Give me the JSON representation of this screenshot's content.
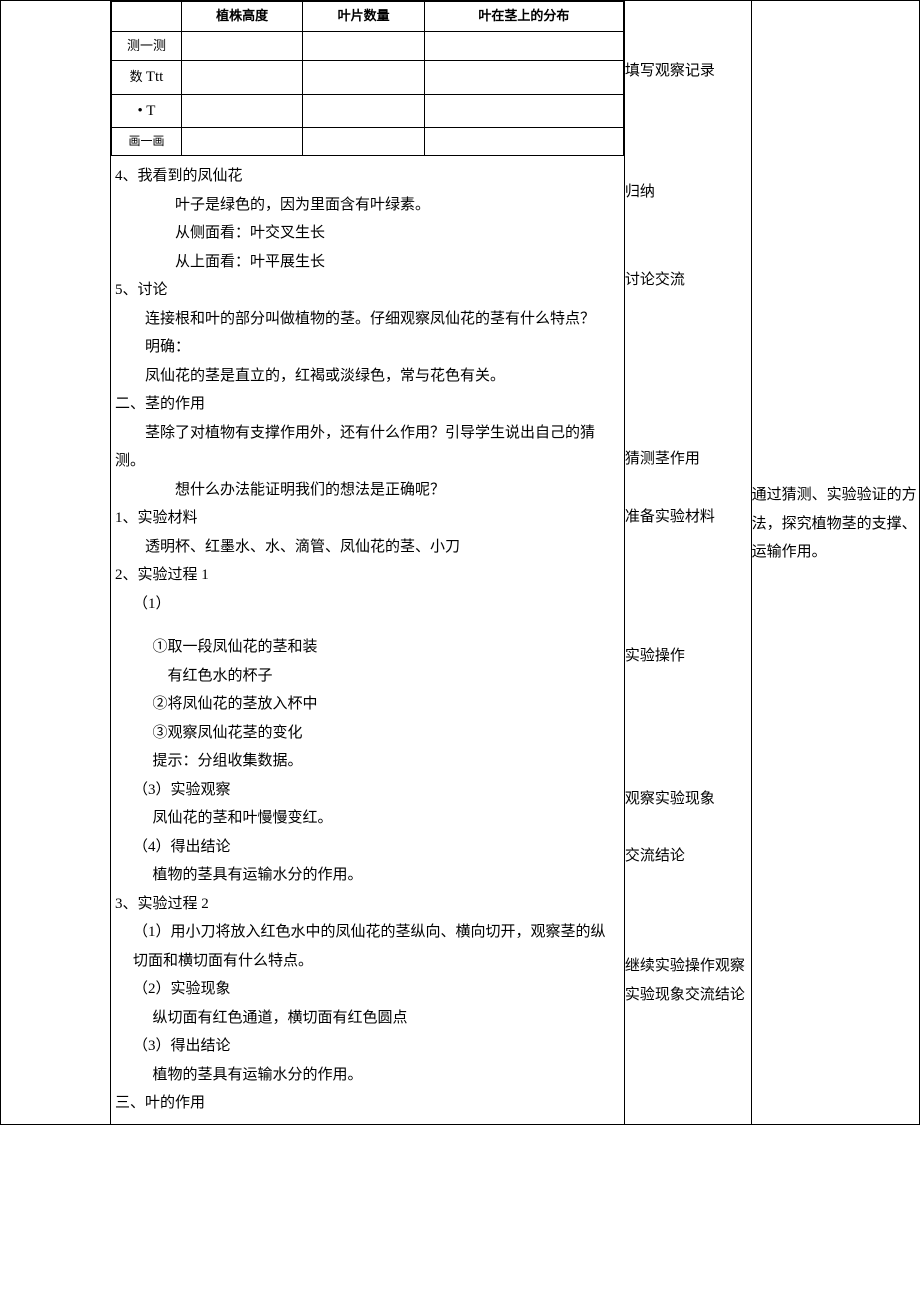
{
  "inner_table": {
    "headers": [
      "",
      "植株高度",
      "叶片数量",
      "叶在茎上的分布"
    ],
    "rows": [
      {
        "label": "测一测"
      },
      {
        "label_html": "数 Ttt"
      },
      {
        "label_html": "• T"
      },
      {
        "label": "画一画"
      }
    ]
  },
  "activities": {
    "a1": "填写观察记录",
    "a2": "归纳",
    "a3": "讨论交流",
    "a4": "猜测茎作用",
    "a5": "准备实验材料",
    "a6": "实验操作",
    "a7": "观察实验现象",
    "a8": "交流结论",
    "a9": "继续实验操作观察实验现象交流结论"
  },
  "note": "通过猜测、实验验证的方法，探究植物茎的支撑、运输作用。",
  "content": {
    "s4_title": "4、我看到的凤仙花",
    "s4_l1": "叶子是绿色的，因为里面含有叶绿素。",
    "s4_l2": "从侧面看：叶交叉生长",
    "s4_l3": "从上面看：叶平展生长",
    "s5_title": "5、讨论",
    "s5_l1": "连接根和叶的部分叫做植物的茎。仔细观察凤仙花的茎有什么特点？",
    "s5_l2": "明确：",
    "s5_l3": "凤仙花的茎是直立的，红褐或淡绿色，常与花色有关。",
    "h2": "二、茎的作用",
    "h2_l1": "茎除了对植物有支撑作用外，还有什么作用？引导学生说出自己的猜测。",
    "h2_l2": "想什么办法能证明我们的想法是正确呢？",
    "mat_title": "1、实验材料",
    "mat_l1": "透明杯、红墨水、水、滴管、凤仙花的茎、小刀",
    "proc1_title": "2、实验过程 1",
    "proc1_sub1": "（1）",
    "proc1_s1": "①取一段凤仙花的茎和装",
    "proc1_s1b": "有红色水的杯子",
    "proc1_s2": "②将凤仙花的茎放入杯中",
    "proc1_s3": "③观察凤仙花茎的变化",
    "proc1_tip": "提示：分组收集数据。",
    "proc1_obs_t": "（3）实验观察",
    "proc1_obs": "凤仙花的茎和叶慢慢变红。",
    "proc1_con_t": "（4）得出结论",
    "proc1_con": "植物的茎具有运输水分的作用。",
    "proc2_title": "3、实验过程 2",
    "proc2_l1": "（1）用小刀将放入红色水中的凤仙花的茎纵向、横向切开，观察茎的纵切面和横切面有什么特点。",
    "proc2_obs_t": "（2）实验现象",
    "proc2_obs": "纵切面有红色通道，横切面有红色圆点",
    "proc2_con_t": "（3）得出结论",
    "proc2_con": "植物的茎具有运输水分的作用。",
    "h3": "三、叶的作用"
  }
}
